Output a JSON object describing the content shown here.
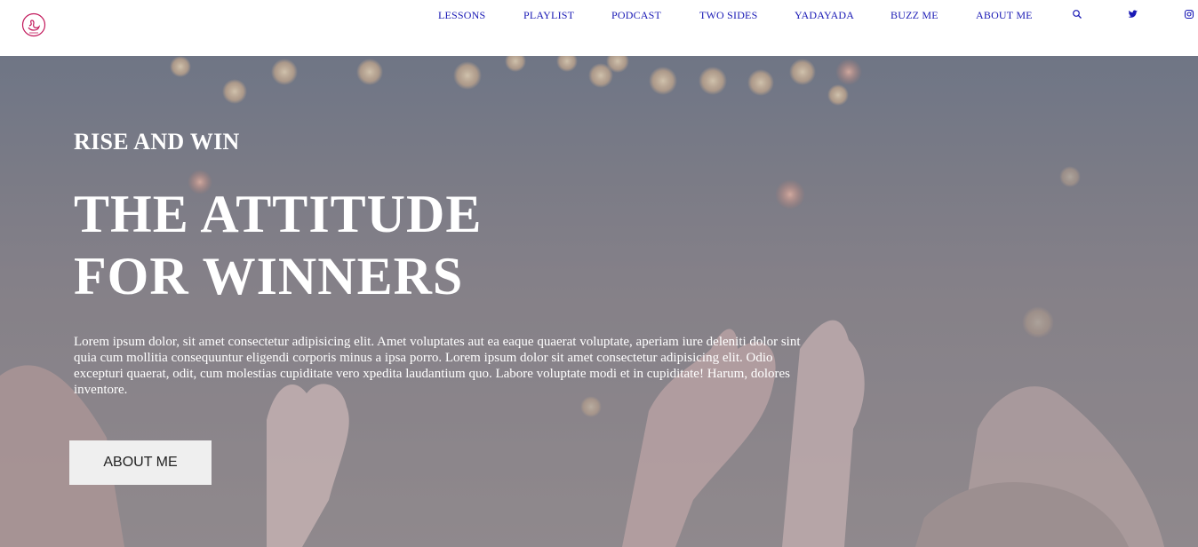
{
  "nav": {
    "items": [
      "LESSONS",
      "PLAYLIST",
      "PODCAST",
      "TWO SIDES",
      "YADAYADA",
      "BUZZ ME",
      "ABOUT ME"
    ],
    "icons": [
      "search-icon",
      "twitter-icon",
      "instagram-icon"
    ]
  },
  "hero": {
    "kicker": "RISE AND WIN",
    "headline_line1": "THE ATTITUDE",
    "headline_line2": "FOR WINNERS",
    "body": "Lorem ipsum dolor, sit amet consectetur adipisicing elit. Amet voluptates aut ea eaque quaerat voluptate, aperiam iure deleniti dolor sint quia cum mollitia consequuntur eligendi corporis minus a ipsa porro. Lorem ipsum dolor sit amet consectetur adipisicing elit. Odio excepturi quaerat, odit, cum molestias cupiditate vero xpedita laudantium quo. Labore voluptate modi et in cupiditate! Harum, dolores inventore.",
    "button_label": "ABOUT ME"
  },
  "colors": {
    "nav_link": "#1a1ab5",
    "logo": "#c2185b",
    "button_bg": "#efefef"
  }
}
